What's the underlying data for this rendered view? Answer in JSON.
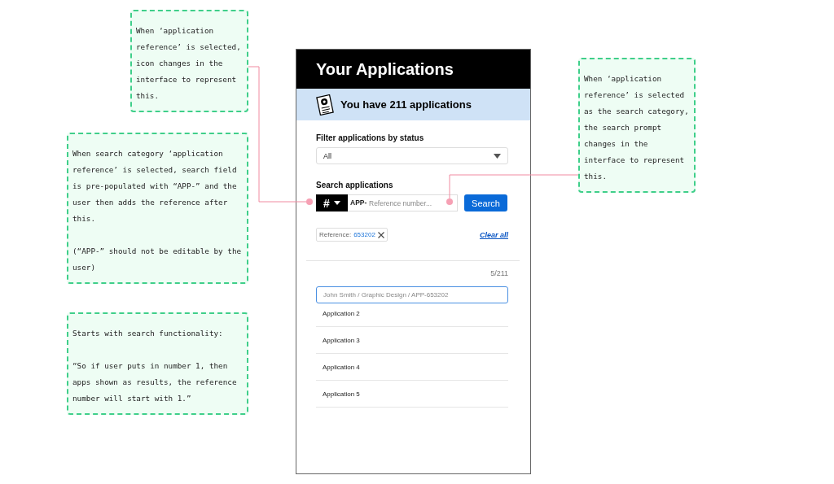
{
  "notes": [
    {
      "paragraphs": [
        "When ‘application reference’ is selected, icon changes in the interface to represent this."
      ]
    },
    {
      "paragraphs": [
        "When search category ‘application reference’ is selected, search field is pre-populated with “APP-” and the user then adds the reference after this.",
        "(“APP-” should not be editable by the user)"
      ]
    },
    {
      "paragraphs": [
        "Starts with search functionality:",
        "“So if user puts in number 1, then apps shown as results, the reference number will start with 1.”"
      ]
    },
    {
      "paragraphs": [
        "When ‘application reference’ is selected as the search category, the search prompt changes in the interface to represent this."
      ]
    }
  ],
  "app": {
    "title": "Your Applications",
    "banner": "You have 211 applications",
    "filter": {
      "label": "Filter applications by status",
      "value": "All"
    },
    "search": {
      "label": "Search applications",
      "category": "#",
      "prefix": "APP-",
      "placeholder": "Reference number...",
      "button": "Search"
    },
    "chips": [
      {
        "label": "Reference:",
        "value": "653202"
      }
    ],
    "clear_all": "Clear all",
    "count": "5/211",
    "results": [
      {
        "label": "John Smith / Graphic Design / APP-653202",
        "selected": true
      },
      {
        "label": "Application 2",
        "selected": false
      },
      {
        "label": "Application 3",
        "selected": false
      },
      {
        "label": "Application 4",
        "selected": false
      },
      {
        "label": "Application 5",
        "selected": false
      }
    ]
  }
}
